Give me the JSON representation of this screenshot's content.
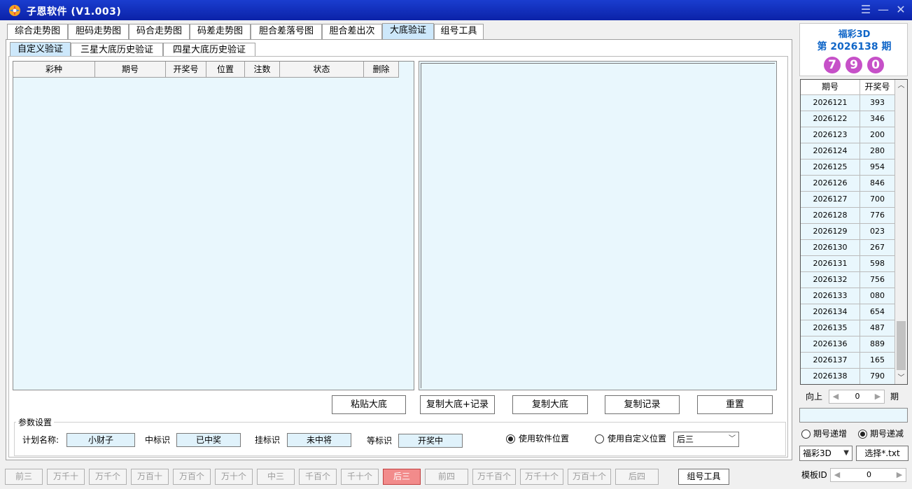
{
  "window": {
    "title": "子恩软件 (V1.003)"
  },
  "main_tabs": [
    "综合走势图",
    "胆码走势图",
    "码合走势图",
    "码差走势图",
    "胆合差落号图",
    "胆合差出次",
    "大底验证",
    "组号工具"
  ],
  "sub_tabs": [
    "自定义验证",
    "三星大底历史验证",
    "四星大底历史验证"
  ],
  "grid_headers": [
    "彩种",
    "期号",
    "开奖号",
    "位置",
    "注数",
    "状态",
    "删除"
  ],
  "action_buttons": [
    "粘贴大底",
    "复制大底+记录",
    "复制大底",
    "复制记录",
    "重置"
  ],
  "params": {
    "group_title": "参数设置",
    "plan_name_label": "计划名称:",
    "plan_name_value": "小财子",
    "hit_label": "中标识",
    "hit_value": "已中奖",
    "hang_label": "挂标识",
    "hang_value": "未中将",
    "wait_label": "等标识",
    "wait_value": "开奖中",
    "radio_software": "使用软件位置",
    "radio_custom": "使用自定义位置",
    "position_select": "后三"
  },
  "bottom_buttons": [
    "前三",
    "万千十",
    "万千个",
    "万百十",
    "万百个",
    "万十个",
    "中三",
    "千百个",
    "千十个",
    "后三",
    "前四",
    "万千百个",
    "万千十个",
    "万百十个",
    "后四",
    "组号工具"
  ],
  "lottery": {
    "name": "福彩3D",
    "period": "第 2026138 期",
    "balls": [
      "7",
      "9",
      "0"
    ]
  },
  "draw_table": {
    "headers": [
      "期号",
      "开奖号"
    ],
    "rows": [
      [
        "2026121",
        "393"
      ],
      [
        "2026122",
        "346"
      ],
      [
        "2026123",
        "200"
      ],
      [
        "2026124",
        "280"
      ],
      [
        "2026125",
        "954"
      ],
      [
        "2026126",
        "846"
      ],
      [
        "2026127",
        "700"
      ],
      [
        "2026128",
        "776"
      ],
      [
        "2026129",
        "023"
      ],
      [
        "2026130",
        "267"
      ],
      [
        "2026131",
        "598"
      ],
      [
        "2026132",
        "756"
      ],
      [
        "2026133",
        "080"
      ],
      [
        "2026134",
        "654"
      ],
      [
        "2026135",
        "487"
      ],
      [
        "2026136",
        "889"
      ],
      [
        "2026137",
        "165"
      ],
      [
        "2026138",
        "790"
      ]
    ]
  },
  "offset": {
    "label": "向上",
    "value": "0",
    "unit": "期"
  },
  "sort": {
    "asc": "期号递增",
    "desc": "期号递减"
  },
  "lottery_select": "福彩3D",
  "choose_file": "选择*.txt",
  "template": {
    "label": "模板ID",
    "value": "0"
  },
  "colors": {
    "title_bar": "#0b22a8",
    "accent": "#1066c8",
    "ball": "#c650c8",
    "grid_bg": "#e9f7fd",
    "active_button": "#f28b8b"
  }
}
